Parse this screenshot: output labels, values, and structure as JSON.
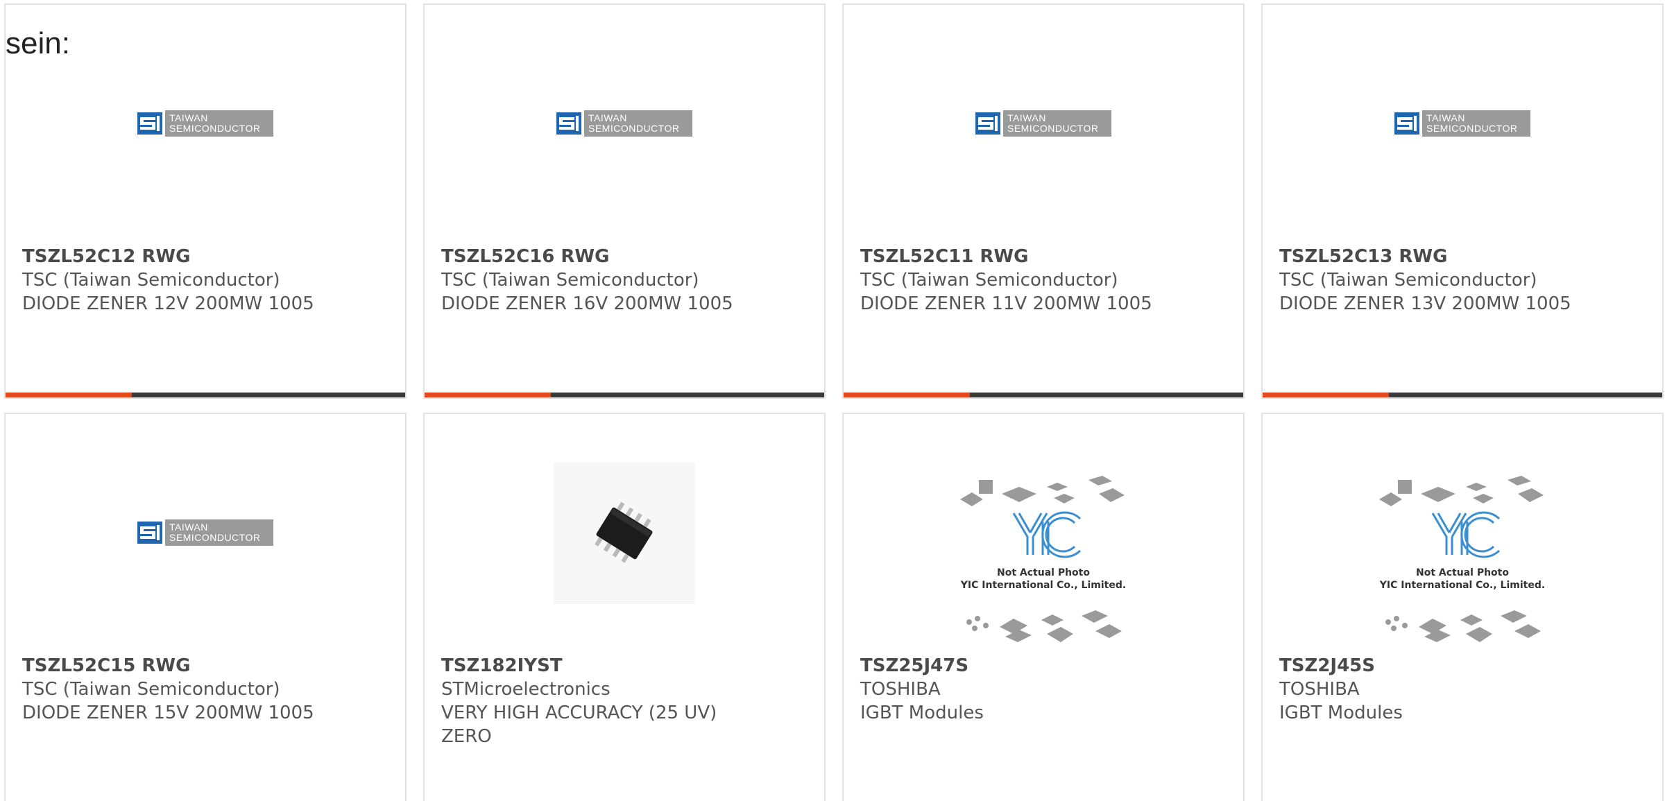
{
  "intro_text": "sein:",
  "colors": {
    "accent": "#e24a1f",
    "bar": "#3a3a3a",
    "card_border": "#e2e2e2",
    "text": "#555555"
  },
  "logos": {
    "tsc": {
      "line1": "TAIWAN",
      "line2": "SEMICONDUCTOR"
    },
    "yic": {
      "caption1": "Not Actual Photo",
      "caption2": "YIC International Co., Limited."
    }
  },
  "products": [
    {
      "part": "TSZL52C12 RWG",
      "manufacturer": "TSC (Taiwan Semiconductor)",
      "description": "DIODE ZENER 12V 200MW 1005",
      "image": "tsc-logo",
      "has_bar": true
    },
    {
      "part": "TSZL52C16 RWG",
      "manufacturer": "TSC (Taiwan Semiconductor)",
      "description": "DIODE ZENER 16V 200MW 1005",
      "image": "tsc-logo",
      "has_bar": true
    },
    {
      "part": "TSZL52C11 RWG",
      "manufacturer": "TSC (Taiwan Semiconductor)",
      "description": "DIODE ZENER 11V 200MW 1005",
      "image": "tsc-logo",
      "has_bar": true
    },
    {
      "part": "TSZL52C13 RWG",
      "manufacturer": "TSC (Taiwan Semiconductor)",
      "description": "DIODE ZENER 13V 200MW 1005",
      "image": "tsc-logo",
      "has_bar": true
    },
    {
      "part": "TSZL52C15 RWG",
      "manufacturer": "TSC (Taiwan Semiconductor)",
      "description": "DIODE ZENER 15V 200MW 1005",
      "image": "tsc-logo",
      "has_bar": false
    },
    {
      "part": "TSZ182IYST",
      "manufacturer": "STMicroelectronics",
      "description": "VERY HIGH ACCURACY (25 UV)",
      "description2": "ZERO",
      "image": "chip-photo",
      "has_bar": false
    },
    {
      "part": "TSZ25J47S",
      "manufacturer": "TOSHIBA",
      "description": "IGBT Modules",
      "image": "yic-placeholder",
      "has_bar": false
    },
    {
      "part": "TSZ2J45S",
      "manufacturer": "TOSHIBA",
      "description": "IGBT Modules",
      "image": "yic-placeholder",
      "has_bar": false
    }
  ]
}
